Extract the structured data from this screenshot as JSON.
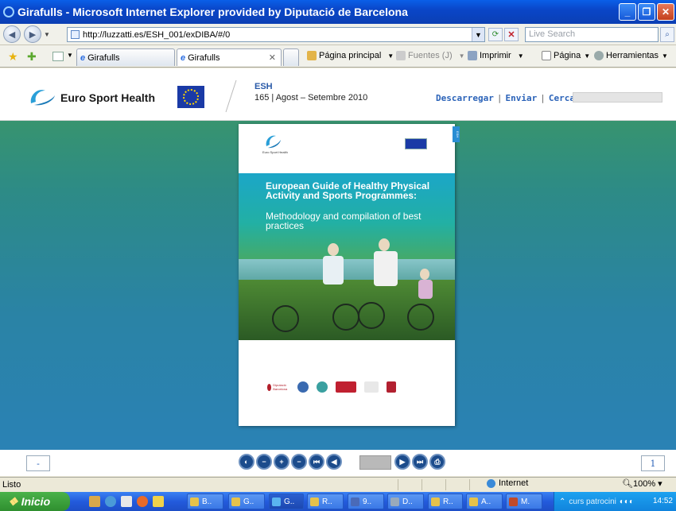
{
  "window": {
    "title": "Girafulls - Microsoft Internet Explorer provided by Diputació de Barcelona"
  },
  "address_bar": {
    "url": "http://luzzatti.es/ESH_001/exDIBA/#/0",
    "search_placeholder": "Live Search"
  },
  "tabs": [
    {
      "label": "Girafulls"
    },
    {
      "label": "Girafulls"
    }
  ],
  "command_bar": {
    "home": "Página principal",
    "feeds": "Fuentes (J)",
    "print": "Imprimir",
    "page": "Página",
    "tools": "Herramientas"
  },
  "site_header": {
    "brand": "Euro Sport Health",
    "esh": "ESH",
    "issue": "165 | Agost – Setembre 2010",
    "links": [
      "Descarregar",
      "Enviar",
      "Cerca"
    ]
  },
  "book": {
    "logo_caption": "Euro Sport Health",
    "cover_title": "European Guide of Healthy Physical Activity and Sports Programmes:",
    "cover_subtitle": "Methodology and compilation of best practices",
    "sponsors": [
      "Diputació Barcelona",
      "",
      "",
      "",
      "",
      ""
    ]
  },
  "viewer": {
    "left_page": "-",
    "right_page": "1",
    "controls": [
      "sound-icon",
      "zoom-out-icon",
      "zoom-in-icon",
      "minus-icon",
      "first-page-icon",
      "prev-page-icon",
      "next-page-icon",
      "last-page-icon",
      "print-icon"
    ]
  },
  "status_bar": {
    "text": "Listo",
    "zone": "Internet",
    "zoom": "100%"
  },
  "taskbar": {
    "start": "Inicio",
    "items": [
      "B..",
      "G..",
      "G..",
      "R..",
      "9..",
      "D..",
      "R..",
      "A..",
      "M."
    ],
    "tray_text": "curs patrocini",
    "clock": "14:52"
  },
  "colors": {
    "title_blue": "#0a46c8",
    "link_blue": "#2a62b8",
    "gradient_green": "#3f9a5e",
    "gradient_blue": "#2a82b8"
  }
}
